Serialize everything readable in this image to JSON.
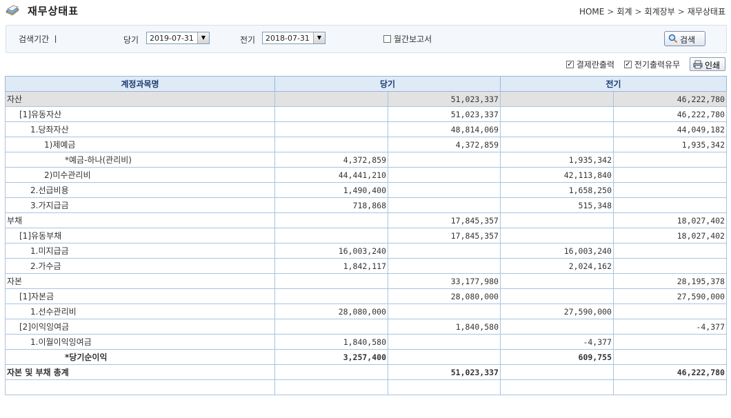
{
  "header": {
    "title": "재무상태표",
    "icon": "book-icon",
    "breadcrumb": [
      "HOME",
      "회계",
      "회계장부",
      "재무상태표"
    ],
    "separator": ">"
  },
  "search": {
    "period_label": "검색기간 ㅣ",
    "current_label": "당기",
    "current_value": "2019-07-31",
    "prior_label": "전기",
    "prior_value": "2018-07-31",
    "monthly_label": "월간보고서",
    "monthly_checked": false,
    "button_label": "검색"
  },
  "options": {
    "approval_label": "결제란출력",
    "approval_checked": true,
    "prior_label": "전기출력유무",
    "prior_checked": true,
    "print_label": "인쇄"
  },
  "table": {
    "headers": [
      "계정과목명",
      "당기",
      "전기"
    ],
    "rows": [
      {
        "indent": 0,
        "name": "자산",
        "c1": "",
        "c2": "51,023,337",
        "p1": "",
        "p2": "46,222,780",
        "style": "hl"
      },
      {
        "indent": 1,
        "name": "[1]유동자산",
        "c1": "",
        "c2": "51,023,337",
        "p1": "",
        "p2": "46,222,780",
        "style": ""
      },
      {
        "indent": 2,
        "name": "1.당좌자산",
        "c1": "",
        "c2": "48,814,069",
        "p1": "",
        "p2": "44,049,182",
        "style": ""
      },
      {
        "indent": 3,
        "name": "1)제예금",
        "c1": "",
        "c2": "4,372,859",
        "p1": "",
        "p2": "1,935,342",
        "style": ""
      },
      {
        "indent": 4,
        "name": "*예금-하나(관리비)",
        "c1": "4,372,859",
        "c2": "",
        "p1": "1,935,342",
        "p2": "",
        "style": ""
      },
      {
        "indent": 3,
        "name": "2)미수관리비",
        "c1": "44,441,210",
        "c2": "",
        "p1": "42,113,840",
        "p2": "",
        "style": ""
      },
      {
        "indent": 2,
        "name": "2.선급비용",
        "c1": "1,490,400",
        "c2": "",
        "p1": "1,658,250",
        "p2": "",
        "style": ""
      },
      {
        "indent": 2,
        "name": "3.가지급금",
        "c1": "718,868",
        "c2": "",
        "p1": "515,348",
        "p2": "",
        "style": ""
      },
      {
        "indent": 0,
        "name": "부채",
        "c1": "",
        "c2": "17,845,357",
        "p1": "",
        "p2": "18,027,402",
        "style": ""
      },
      {
        "indent": 1,
        "name": "[1]유동부채",
        "c1": "",
        "c2": "17,845,357",
        "p1": "",
        "p2": "18,027,402",
        "style": ""
      },
      {
        "indent": 2,
        "name": "1.미지급금",
        "c1": "16,003,240",
        "c2": "",
        "p1": "16,003,240",
        "p2": "",
        "style": ""
      },
      {
        "indent": 2,
        "name": "2.가수금",
        "c1": "1,842,117",
        "c2": "",
        "p1": "2,024,162",
        "p2": "",
        "style": ""
      },
      {
        "indent": 0,
        "name": "자본",
        "c1": "",
        "c2": "33,177,980",
        "p1": "",
        "p2": "28,195,378",
        "style": ""
      },
      {
        "indent": 1,
        "name": "[1]자본금",
        "c1": "",
        "c2": "28,080,000",
        "p1": "",
        "p2": "27,590,000",
        "style": ""
      },
      {
        "indent": 2,
        "name": "1.선수관리비",
        "c1": "28,080,000",
        "c2": "",
        "p1": "27,590,000",
        "p2": "",
        "style": ""
      },
      {
        "indent": 1,
        "name": "[2]이익잉여금",
        "c1": "",
        "c2": "1,840,580",
        "p1": "",
        "p2": "-4,377",
        "style": ""
      },
      {
        "indent": 2,
        "name": "1.이월이익잉여금",
        "c1": "1,840,580",
        "c2": "",
        "p1": "-4,377",
        "p2": "",
        "style": ""
      },
      {
        "indent": 4,
        "name": "*당기순이익",
        "c1": "3,257,400",
        "c2": "",
        "p1": "609,755",
        "p2": "",
        "style": "bold"
      },
      {
        "indent": 0,
        "name": "자본 및 부채 총계",
        "c1": "",
        "c2": "51,023,337",
        "p1": "",
        "p2": "46,222,780",
        "style": "total"
      },
      {
        "indent": 0,
        "name": "",
        "c1": "",
        "c2": "",
        "p1": "",
        "p2": "",
        "style": ""
      }
    ]
  }
}
